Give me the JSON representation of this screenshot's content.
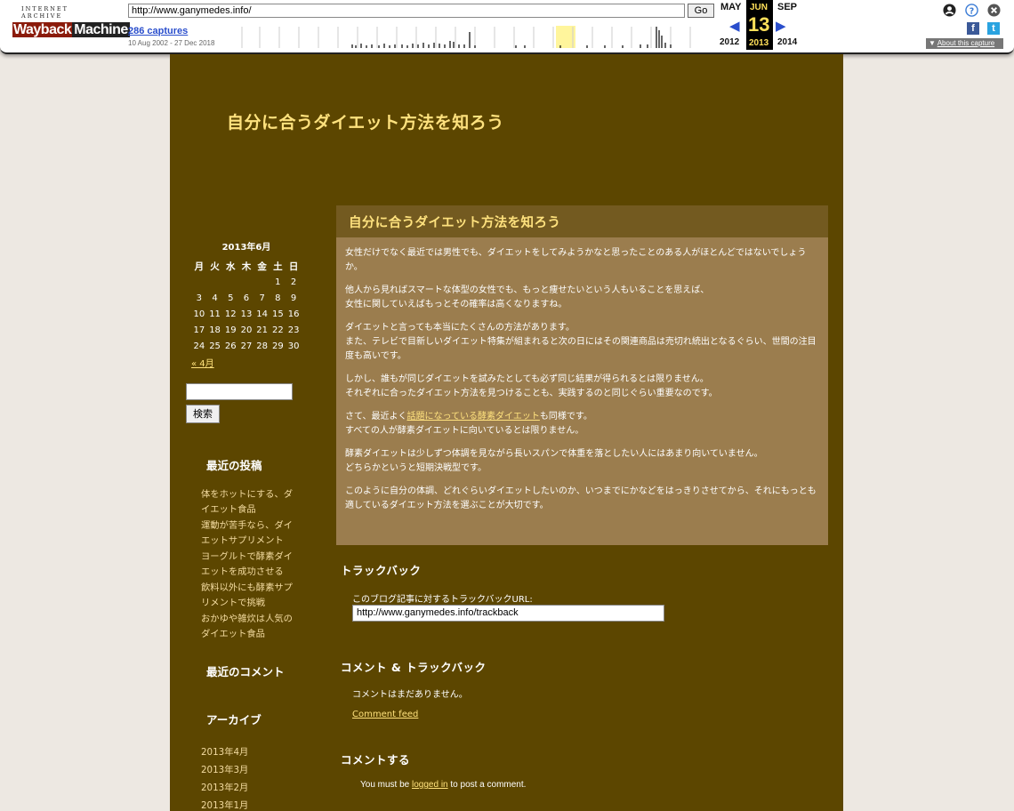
{
  "wayback": {
    "logo_top": "INTERNET ARCHIVE",
    "logo_main_a": "Wayback",
    "logo_main_b": "Machine",
    "url": "http://www.ganymedes.info/",
    "go_label": "Go",
    "captures": "286 captures",
    "range": "10 Aug 2002 - 27 Dec 2018",
    "prev_month": "MAY",
    "cur_month": "JUN",
    "next_month": "SEP",
    "prev_year": "2012",
    "cur_day": "13",
    "cur_year": "2013",
    "next_year": "2014",
    "about": "About this capture",
    "facebook": "f",
    "twitter": "t"
  },
  "blog": {
    "title": "自分に合うダイエット方法を知ろう"
  },
  "calendar": {
    "caption": "2013年6月",
    "weekdays": [
      "月",
      "火",
      "水",
      "木",
      "金",
      "土",
      "日"
    ],
    "weeks": [
      [
        "",
        "",
        "",
        "",
        "",
        "1",
        "2"
      ],
      [
        "3",
        "4",
        "5",
        "6",
        "7",
        "8",
        "9"
      ],
      [
        "10",
        "11",
        "12",
        "13",
        "14",
        "15",
        "16"
      ],
      [
        "17",
        "18",
        "19",
        "20",
        "21",
        "22",
        "23"
      ],
      [
        "24",
        "25",
        "26",
        "27",
        "28",
        "29",
        "30"
      ]
    ],
    "prev": "« 4月"
  },
  "search": {
    "button": "検索"
  },
  "sidebar": {
    "recent_posts_title": "最近の投稿",
    "recent_posts": [
      "体をホットにする、ダイエット食品",
      "運動が苦手なら、ダイエットサプリメント",
      "ヨーグルトで酵素ダイエットを成功させる",
      "飲料以外にも酵素サプリメントで挑戦",
      "おかゆや雑炊は人気のダイエット食品"
    ],
    "recent_comments_title": "最近のコメント",
    "archives_title": "アーカイブ",
    "archives": [
      "2013年4月",
      "2013年3月",
      "2013年2月",
      "2013年1月"
    ]
  },
  "post": {
    "title": "自分に合うダイエット方法を知ろう",
    "p1": "女性だけでなく最近では男性でも、ダイエットをしてみようかなと思ったことのある人がほとんどではないでしょうか。",
    "p2a": "他人から見ればスマートな体型の女性でも、もっと痩せたいという人もいることを思えば、",
    "p2b": "女性に関していえばもっとその確率は高くなりますね。",
    "p3a": "ダイエットと言っても本当にたくさんの方法があります。",
    "p3b": "また、テレビで目新しいダイエット特集が組まれると次の日にはその関連商品は売切れ続出となるぐらい、世間の注目度も高いです。",
    "p4a": "しかし、誰もが同じダイエットを試みたとしても必ず同じ結果が得られるとは限りません。",
    "p4b": "それぞれに合ったダイエット方法を見つけることも、実践するのと同じぐらい重要なのです。",
    "p5_pre": "さて、最近よく",
    "p5_link": "話題になっている酵素ダイエット",
    "p5_post": "も同様です。",
    "p5b": "すべての人が酵素ダイエットに向いているとは限りません。",
    "p6a": "酵素ダイエットは少しずつ体調を見ながら長いスパンで体重を落としたい人にはあまり向いていません。",
    "p6b": "どちらかというと短期決戦型です。",
    "p7": "このように自分の体調、どれぐらいダイエットしたいのか、いつまでにかなどをはっきりさせてから、それにもっとも適しているダイエット方法を選ぶことが大切です。"
  },
  "trackback": {
    "title": "トラックバック",
    "label": "このブログ記事に対するトラックバックURL:",
    "url": "http://www.ganymedes.info/trackback"
  },
  "comments": {
    "title": "コメント & トラックバック",
    "none": "コメントはまだありません。",
    "feed": "Comment feed",
    "form_title": "コメントする",
    "login_pre": "You must be ",
    "login_link": "logged in",
    "login_post": " to post a comment."
  },
  "colors": {
    "page_bg": "#5c4600",
    "post_bg": "#9b7d4e",
    "post_title_bg": "#735a20",
    "accent": "#ffe27e",
    "outer_bg": "#ede8e2"
  }
}
